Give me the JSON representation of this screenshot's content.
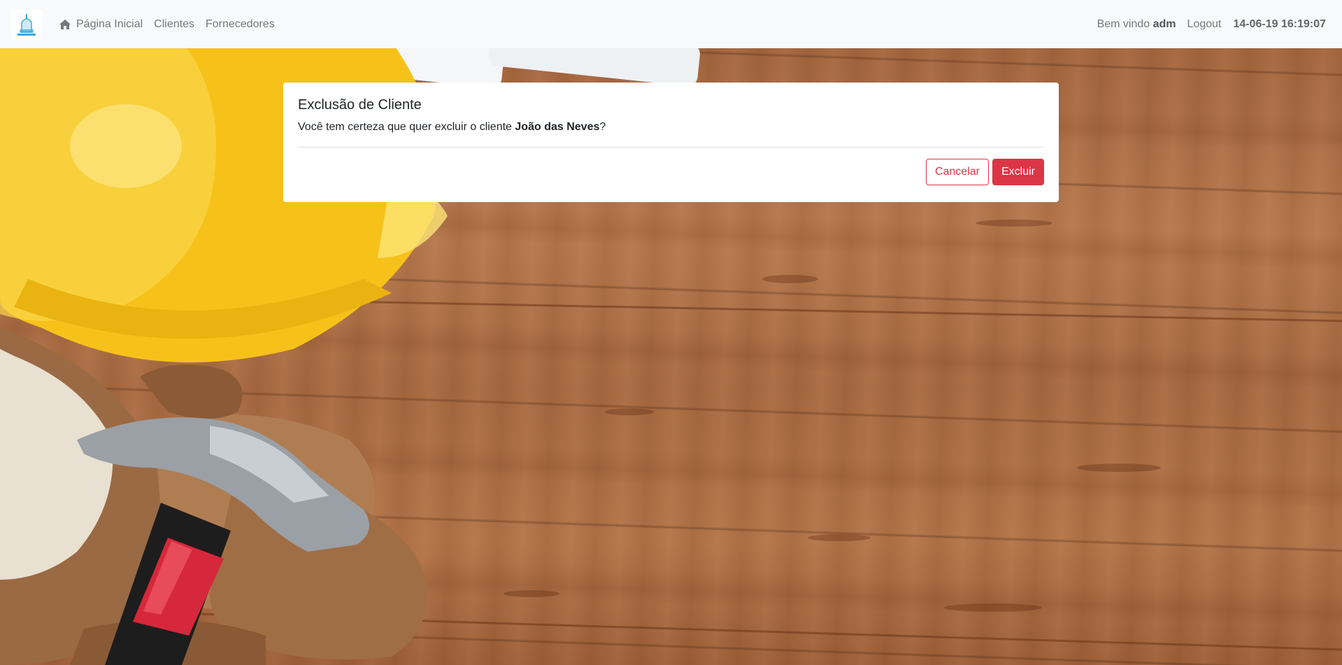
{
  "navbar": {
    "logo_icon": "building-logo-icon",
    "links": [
      {
        "label": "Página Inicial",
        "icon": "home-icon"
      },
      {
        "label": "Clientes"
      },
      {
        "label": "Fornecedores"
      }
    ],
    "welcome_prefix": "Bem vindo",
    "username": "adm",
    "logout_label": "Logout",
    "datetime": "14-06-19 16:19:07"
  },
  "modal": {
    "title": "Exclusão de Cliente",
    "message_prefix": "Você tem certeza que quer excluir o cliente",
    "client_name": "João das Neves",
    "message_suffix": "?",
    "cancel_label": "Cancelar",
    "delete_label": "Excluir"
  },
  "colors": {
    "danger": "#dc3545",
    "navbar_bg": "#f8f9fa",
    "wood": "#b0703f",
    "helmet": "#f5c518"
  }
}
